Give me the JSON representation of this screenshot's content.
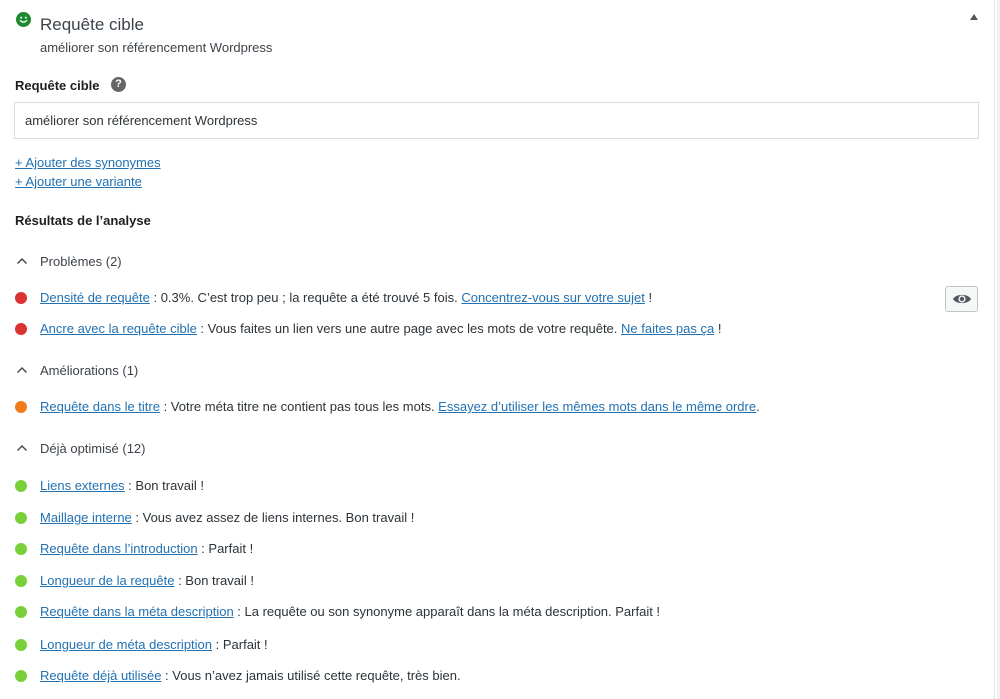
{
  "header": {
    "title": "Requête cible",
    "subtitle": "améliorer son référencement Wordpress",
    "status_color": "#1e8a2e"
  },
  "field": {
    "label": "Requête cible",
    "value": "améliorer son référencement Wordpress"
  },
  "links": {
    "synonyms": "+ Ajouter des synonymes",
    "variant": "+ Ajouter une variante"
  },
  "analysis": {
    "heading": "Résultats de l’analyse",
    "groups": {
      "problems": {
        "label": "Problèmes (2)"
      },
      "improvements": {
        "label": "Améliorations (1)"
      },
      "optimized": {
        "label": "Déjà optimisé (12)"
      }
    },
    "items": [
      {
        "link": "Densité de requête",
        "text": " : 0.3%. C’est trop peu ; la requête a été trouvé 5 fois. ",
        "cta": "Concentrez-vous sur votre sujet",
        "tail": " !",
        "color": "#dc3232"
      },
      {
        "link": "Ancre avec la requête cible",
        "text": " : Vous faites un lien vers une autre page avec les mots de votre requête. ",
        "cta": "Ne faites pas ça",
        "tail": " !",
        "color": "#dc3232"
      },
      {
        "link": "Requête dans le titre",
        "text": " : Votre méta titre ne contient pas tous les mots. ",
        "cta": "Essayez d’utiliser les mêmes mots dans le même ordre",
        "tail": ".",
        "color": "#ee7c1b"
      },
      {
        "link": "Liens externes",
        "text": " : Bon travail !",
        "color": "#7ad03a"
      },
      {
        "link": "Maillage interne",
        "text": " : Vous avez assez de liens internes. Bon travail !",
        "color": "#7ad03a"
      },
      {
        "link": "Requête dans l’introduction",
        "text": " : Parfait !",
        "color": "#7ad03a"
      },
      {
        "link": "Longueur de la requête",
        "text": " : Bon travail !",
        "color": "#7ad03a"
      },
      {
        "link": "Requête dans la méta description",
        "text": " : La requête ou son synonyme apparaît dans la méta description. Parfait !",
        "color": "#7ad03a"
      },
      {
        "link": "Longueur de méta description",
        "text": " : Parfait !",
        "color": "#7ad03a"
      },
      {
        "link": "Requête déjà utilisée",
        "text": " : Vous n’avez jamais utilisé cette requête, très bien.",
        "color": "#7ad03a"
      }
    ]
  },
  "icons": {
    "status": "smiley-icon",
    "collapse": "triangle-up-icon",
    "help": "question-circle-icon",
    "group_toggle": "chevron-up-icon",
    "marker": "eye-icon"
  }
}
